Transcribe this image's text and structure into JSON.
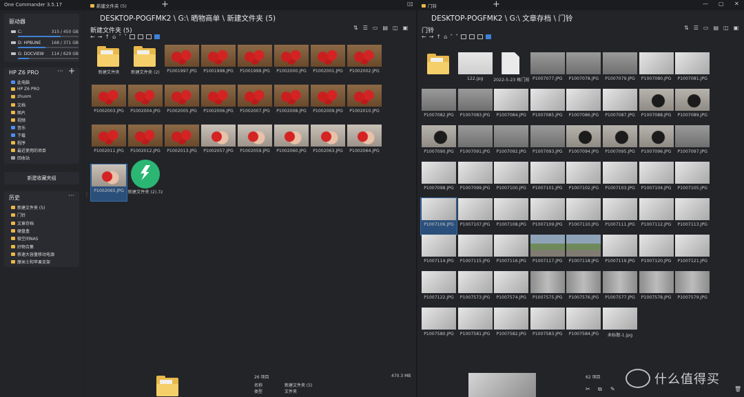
{
  "app": {
    "title": "One Commander 3.5.17"
  },
  "tabs": [
    {
      "label": "新建文件夹 (5)"
    },
    {
      "label": "门铃"
    }
  ],
  "sidebar": {
    "drives_title": "驱动器",
    "drives": [
      {
        "name": "C:",
        "size": "315 / 450 GB",
        "used": 0.7
      },
      {
        "name": "D: HPBUNE",
        "size": "168 / 371 GB",
        "used": 0.45
      },
      {
        "name": "G: DOCVIEW",
        "size": "114 / 629 GB",
        "used": 0.18
      }
    ],
    "favorites_title": "HP Z6 PRO",
    "favorites": [
      {
        "label": "此电脑",
        "icon": "computer-icon"
      },
      {
        "label": "HP Z6 PRO",
        "icon": "folder-icon"
      },
      {
        "label": "zhuom",
        "icon": "folder-icon"
      },
      {
        "label": "文档",
        "icon": "folder-icon"
      },
      {
        "label": "图片",
        "icon": "folder-icon"
      },
      {
        "label": "视频",
        "icon": "folder-icon"
      },
      {
        "label": "音乐",
        "icon": "music-icon"
      },
      {
        "label": "下载",
        "icon": "download-icon"
      },
      {
        "label": "程序",
        "icon": "folder-icon"
      },
      {
        "label": "最近使用的项目",
        "icon": "folder-icon"
      },
      {
        "label": "回收站",
        "icon": "trash-icon"
      }
    ],
    "new_group_label": "新建收藏夹组",
    "history_title": "历史",
    "history": [
      {
        "label": "新建文件夹 (5)"
      },
      {
        "label": "门铃"
      },
      {
        "label": "文章存档"
      },
      {
        "label": "硬盘盒"
      },
      {
        "label": "极空间NAS"
      },
      {
        "label": "好物合集"
      },
      {
        "label": "移速大容量移动电源"
      },
      {
        "label": "摩米士和苹果支架"
      }
    ]
  },
  "left_panel": {
    "path": "DESKTOP-POGFMK2 \\ G:\\ 晒物商单 \\ 新建文件夹 (5)",
    "folder_title": "新建文件夹 (5)",
    "files": [
      {
        "name": "新建文件夹",
        "kind": "folder"
      },
      {
        "name": "新建文件夹 (2)",
        "kind": "folder"
      },
      {
        "name": "P1001997.JPG",
        "kind": "straw"
      },
      {
        "name": "P1001998.JPG",
        "kind": "straw"
      },
      {
        "name": "P1001999.JPG",
        "kind": "straw"
      },
      {
        "name": "P1002000.JPG",
        "kind": "straw"
      },
      {
        "name": "P1002001.JPG",
        "kind": "straw"
      },
      {
        "name": "P1002002.JPG",
        "kind": "straw"
      },
      {
        "name": "P1002003.JPG",
        "kind": "straw"
      },
      {
        "name": "P1002004.JPG",
        "kind": "straw"
      },
      {
        "name": "P1002005.JPG",
        "kind": "straw"
      },
      {
        "name": "P1002006.JPG",
        "kind": "straw"
      },
      {
        "name": "P1002007.JPG",
        "kind": "straw"
      },
      {
        "name": "P1002008.JPG",
        "kind": "straw"
      },
      {
        "name": "P1002009.JPG",
        "kind": "straw"
      },
      {
        "name": "P1002010.JPG",
        "kind": "straw"
      },
      {
        "name": "P1002011.JPG",
        "kind": "straw"
      },
      {
        "name": "P1002012.JPG",
        "kind": "straw"
      },
      {
        "name": "P1002013.JPG",
        "kind": "straw"
      },
      {
        "name": "P1002057.JPG",
        "kind": "hand"
      },
      {
        "name": "P1002059.JPG",
        "kind": "hand"
      },
      {
        "name": "P1002060.JPG",
        "kind": "hand"
      },
      {
        "name": "P1002063.JPG",
        "kind": "hand"
      },
      {
        "name": "P1002064.JPG",
        "kind": "hand"
      },
      {
        "name": "P1002065.JPG",
        "kind": "hand"
      },
      {
        "name": "新建文件夹 (2).7z",
        "kind": "zip"
      }
    ],
    "status": {
      "count": "26 项目",
      "size": "470.3 MB",
      "name_label": "名称",
      "name_value": "新建文件夹 (5)",
      "type_label": "类型",
      "type_value": "文件夹"
    }
  },
  "right_panel": {
    "path": "DESKTOP-POGFMK2 \\ G:\\ 文章存档 \\ 门铃",
    "folder_title": "门铃",
    "files": [
      {
        "name": "",
        "kind": "folder"
      },
      {
        "name": "122.jpg",
        "kind": "doc"
      },
      {
        "name": "2022-5-23 格门前面带安装小视...",
        "kind": "pdf"
      },
      {
        "name": "P1007077.JPG",
        "kind": "gray"
      },
      {
        "name": "P1007078.JPG",
        "kind": "gray"
      },
      {
        "name": "P1007079.JPG",
        "kind": "gray"
      },
      {
        "name": "P1007080.JPG",
        "kind": "white"
      },
      {
        "name": "P1007081.JPG",
        "kind": "white"
      },
      {
        "name": "P1007082.JPG",
        "kind": "gray"
      },
      {
        "name": "P1007083.JPG",
        "kind": "gray"
      },
      {
        "name": "P1007084.JPG",
        "kind": "white"
      },
      {
        "name": "P1007085.JPG",
        "kind": "white"
      },
      {
        "name": "P1007086.JPG",
        "kind": "white"
      },
      {
        "name": "P1007087.JPG",
        "kind": "white"
      },
      {
        "name": "P1007088.JPG",
        "kind": "dark"
      },
      {
        "name": "P1007089.JPG",
        "kind": "dark"
      },
      {
        "name": "P1007090.JPG",
        "kind": "dark"
      },
      {
        "name": "P1007091.JPG",
        "kind": "gray"
      },
      {
        "name": "P1007092.JPG",
        "kind": "gray"
      },
      {
        "name": "P1007093.JPG",
        "kind": "gray"
      },
      {
        "name": "P1007094.JPG",
        "kind": "dark"
      },
      {
        "name": "P1007095.JPG",
        "kind": "dark"
      },
      {
        "name": "P1007096.JPG",
        "kind": "dark"
      },
      {
        "name": "P1007097.JPG",
        "kind": "gray"
      },
      {
        "name": "P1007098.JPG",
        "kind": "white"
      },
      {
        "name": "P1007099.JPG",
        "kind": "white"
      },
      {
        "name": "P1007100.JPG",
        "kind": "white"
      },
      {
        "name": "P1007101.JPG",
        "kind": "white"
      },
      {
        "name": "P1007102.JPG",
        "kind": "white"
      },
      {
        "name": "P1007103.JPG",
        "kind": "white"
      },
      {
        "name": "P1007104.JPG",
        "kind": "white"
      },
      {
        "name": "P1007105.JPG",
        "kind": "white"
      },
      {
        "name": "P1007106.JPG",
        "kind": "white"
      },
      {
        "name": "P1007107.JPG",
        "kind": "white"
      },
      {
        "name": "P1007108.JPG",
        "kind": "white"
      },
      {
        "name": "P1007109.JPG",
        "kind": "white"
      },
      {
        "name": "P1007110.JPG",
        "kind": "white"
      },
      {
        "name": "P1007111.JPG",
        "kind": "white"
      },
      {
        "name": "P1007112.JPG",
        "kind": "white"
      },
      {
        "name": "P1007113.JPG",
        "kind": "white"
      },
      {
        "name": "P1007114.JPG",
        "kind": "white"
      },
      {
        "name": "P1007115.JPG",
        "kind": "white"
      },
      {
        "name": "P1007116.JPG",
        "kind": "white"
      },
      {
        "name": "P1007117.JPG",
        "kind": "outdoor"
      },
      {
        "name": "P1007118.JPG",
        "kind": "outdoor"
      },
      {
        "name": "P1007119.JPG",
        "kind": "white"
      },
      {
        "name": "P1007120.JPG",
        "kind": "white"
      },
      {
        "name": "P1007121.JPG",
        "kind": "white"
      },
      {
        "name": "P1007122.JPG",
        "kind": "white"
      },
      {
        "name": "P1007573.JPG",
        "kind": "white"
      },
      {
        "name": "P1007574.JPG",
        "kind": "white"
      },
      {
        "name": "P1007575.JPG",
        "kind": "door"
      },
      {
        "name": "P1007576.JPG",
        "kind": "door"
      },
      {
        "name": "P1007577.JPG",
        "kind": "door"
      },
      {
        "name": "P1007578.JPG",
        "kind": "door"
      },
      {
        "name": "P1007579.JPG",
        "kind": "door"
      },
      {
        "name": "P1007580.JPG",
        "kind": "white"
      },
      {
        "name": "P1007581.JPG",
        "kind": "white"
      },
      {
        "name": "P1007582.JPG",
        "kind": "white"
      },
      {
        "name": "P1007583.JPG",
        "kind": "white"
      },
      {
        "name": "P1007584.JPG",
        "kind": "white"
      },
      {
        "name": "未标题-1.jpg",
        "kind": "white"
      }
    ],
    "status": {
      "count": "62 项目"
    }
  },
  "watermark": {
    "text": "什么值得买"
  }
}
